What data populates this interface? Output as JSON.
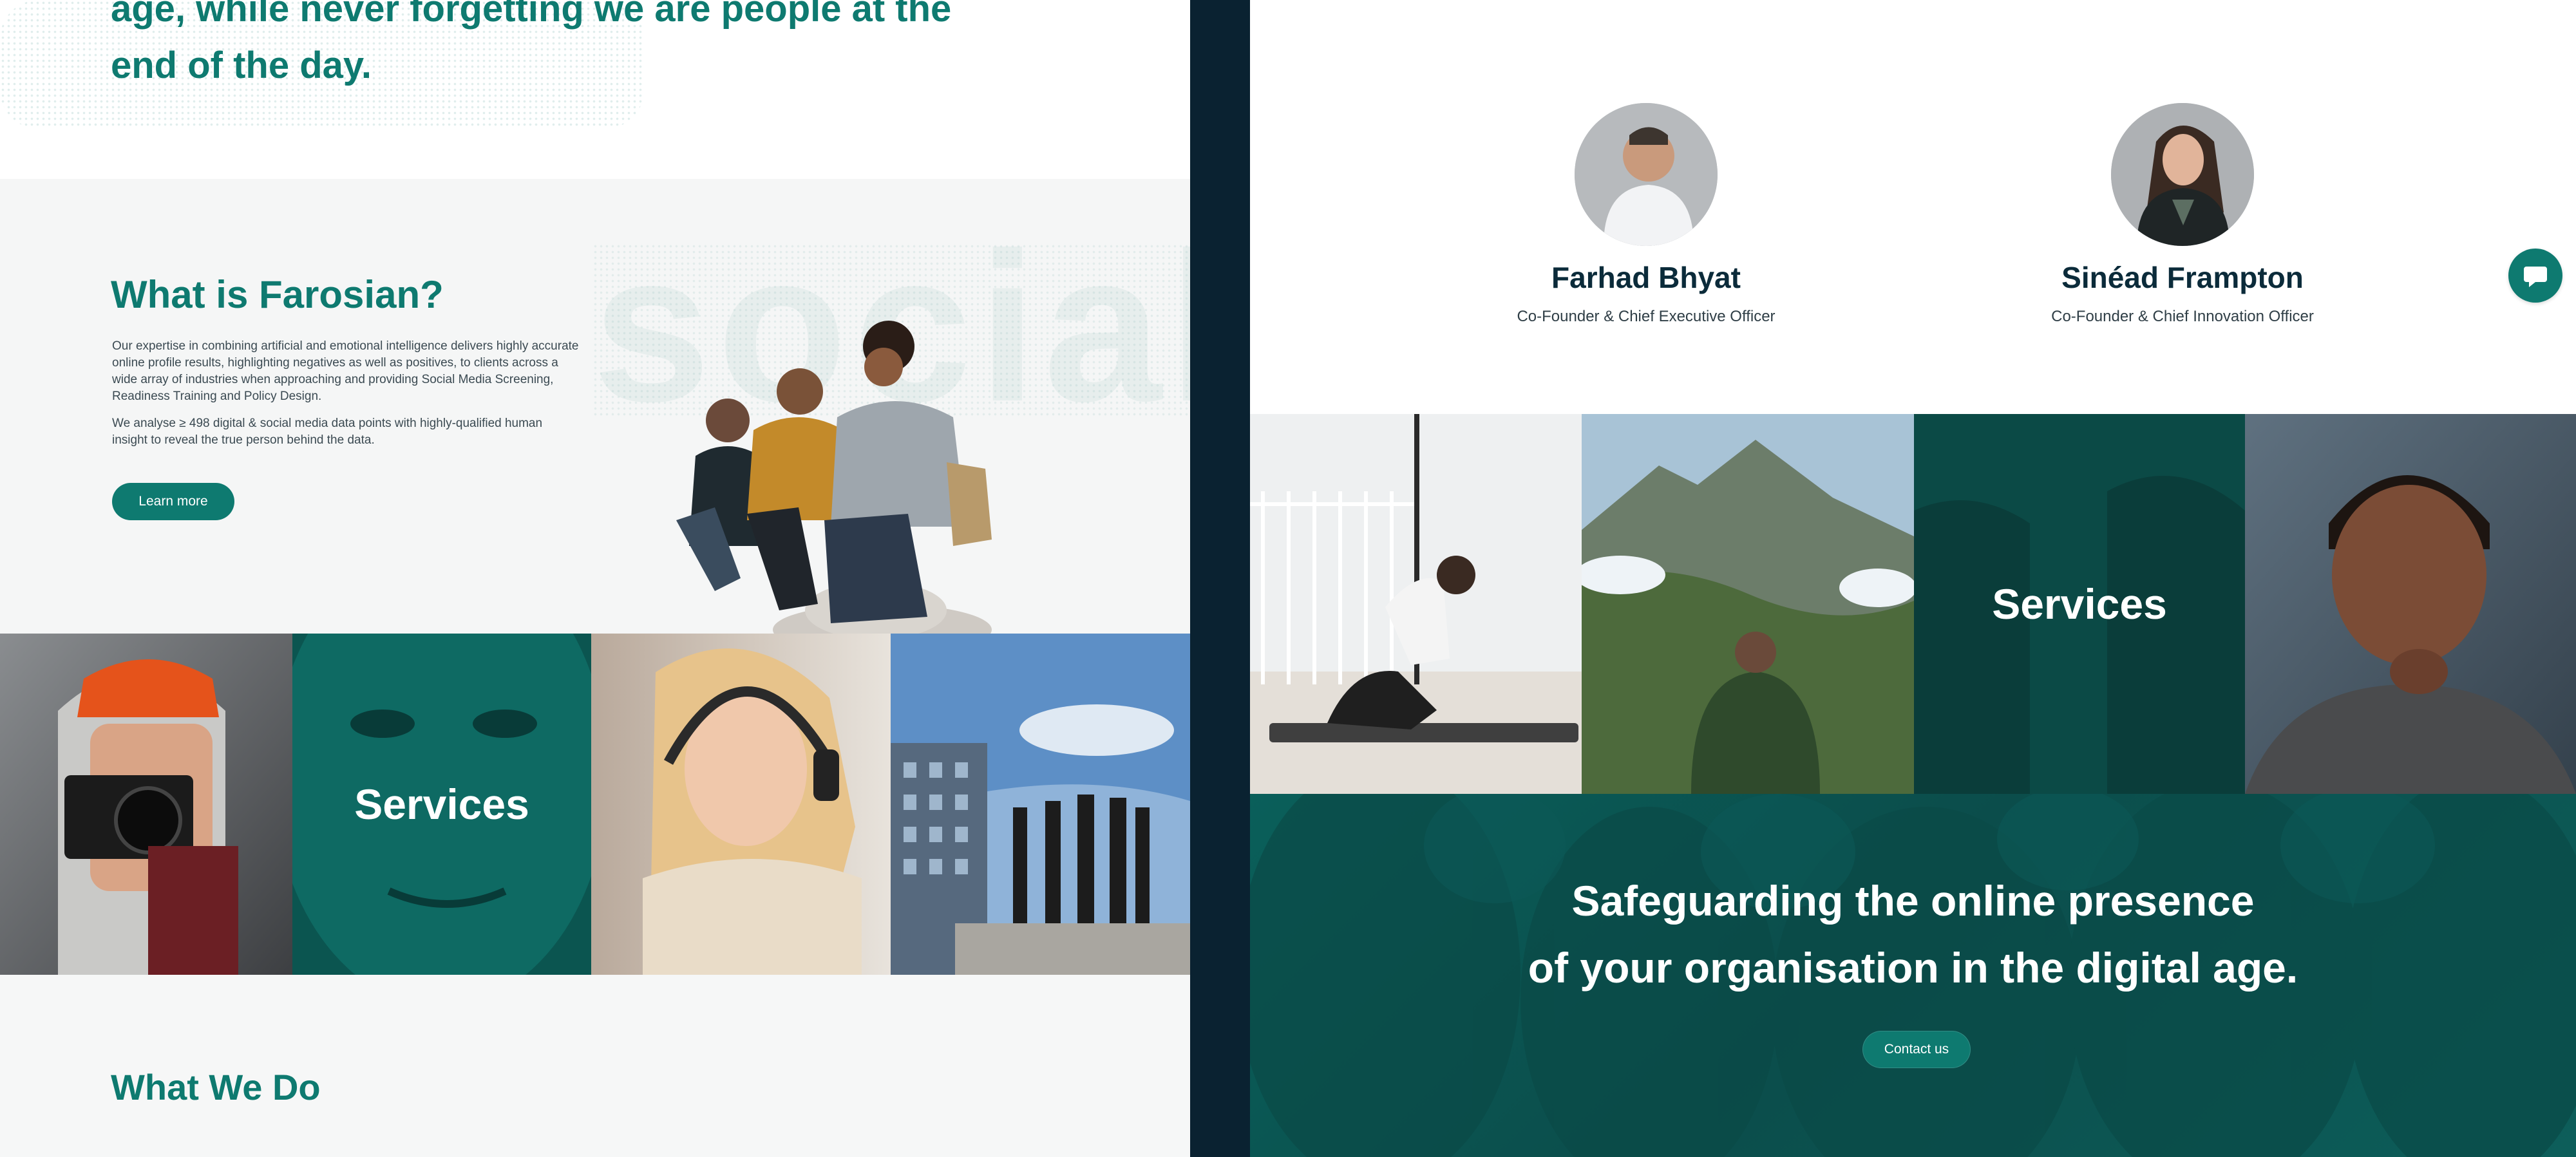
{
  "hero": {
    "line1": "age, while never forgetting we are people at the",
    "line2": "end of the day."
  },
  "about": {
    "watermark": "social",
    "title": "What is Farosian?",
    "para1": "Our expertise in combining artificial and emotional intelligence delivers highly accurate online profile results, highlighting negatives as well as positives, to clients across a wide array of industries when approaching and providing Social Media Screening, Readiness Training and Policy Design.",
    "para2": "We analyse ≥ 498 digital & social media data points with highly-qualified human insight to reveal the true person behind the data.",
    "button": "Learn more"
  },
  "left_strip": {
    "services_label": "Services"
  },
  "what_we_do": {
    "title": "What We Do"
  },
  "team": {
    "members": [
      {
        "name": "Farhad Bhyat",
        "role": "Co-Founder & Chief Executive Officer"
      },
      {
        "name": "Sinéad Frampton",
        "role": "Co-Founder & Chief Innovation Officer"
      }
    ]
  },
  "right_strip": {
    "services_label": "Services"
  },
  "cta": {
    "line1": "Safeguarding the online presence",
    "line2": "of your organisation in the digital age.",
    "button": "Contact us"
  },
  "chat": {
    "icon": "chat-bubble-icon"
  },
  "colors": {
    "brand_teal": "#0e7a70",
    "dark_navy": "#0a2231",
    "text_dark": "#0b2b3a"
  }
}
